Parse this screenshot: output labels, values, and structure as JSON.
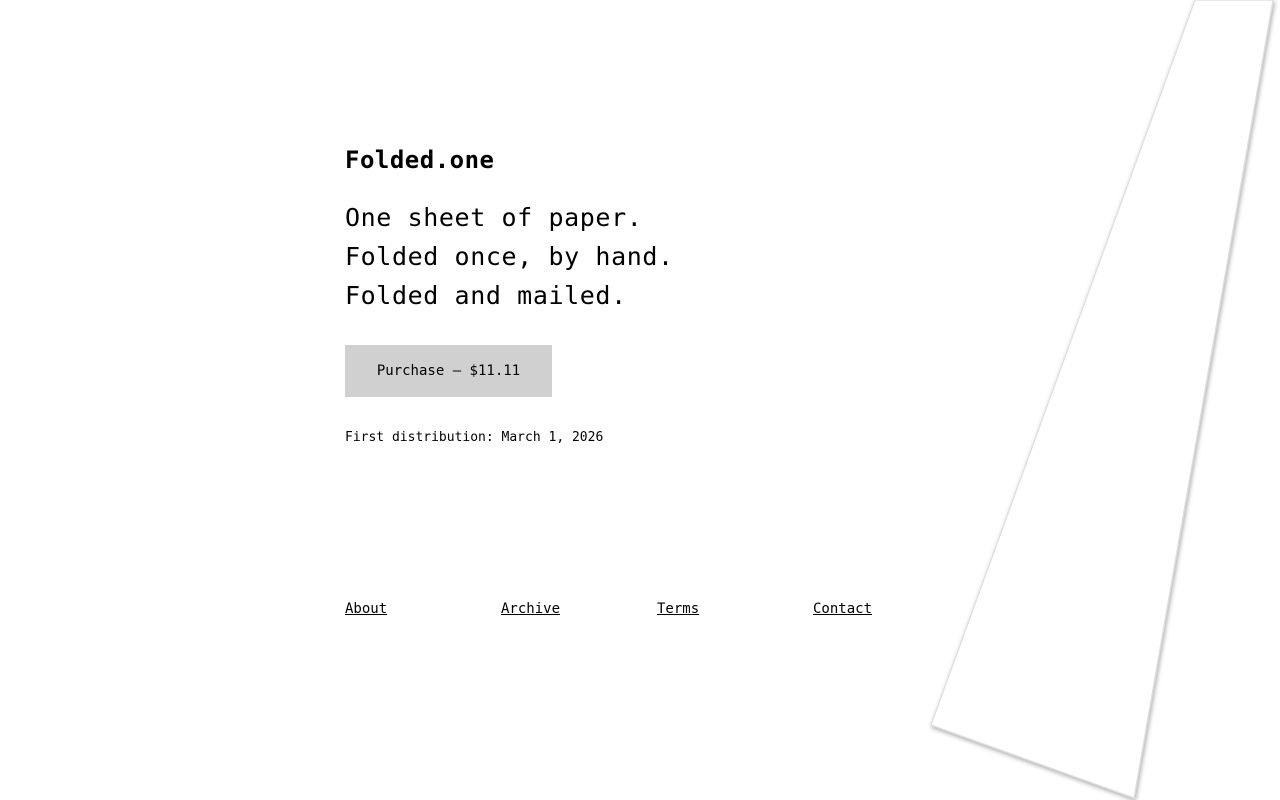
{
  "site": {
    "title": "Folded.one"
  },
  "tagline": {
    "line1": "One sheet of paper.",
    "line2": "Folded once, by hand.",
    "line3": "Folded and mailed."
  },
  "purchase": {
    "label": "Purchase — $11.11"
  },
  "distribution": {
    "text": "First distribution: March 1, 2026"
  },
  "footer": {
    "links": [
      {
        "label": "About"
      },
      {
        "label": "Archive"
      },
      {
        "label": "Terms"
      },
      {
        "label": "Contact"
      }
    ]
  },
  "colors": {
    "background": "#ffffff",
    "text": "#000000",
    "button_bg": "#d0d0d0",
    "paper_edge": "#dddddd"
  }
}
